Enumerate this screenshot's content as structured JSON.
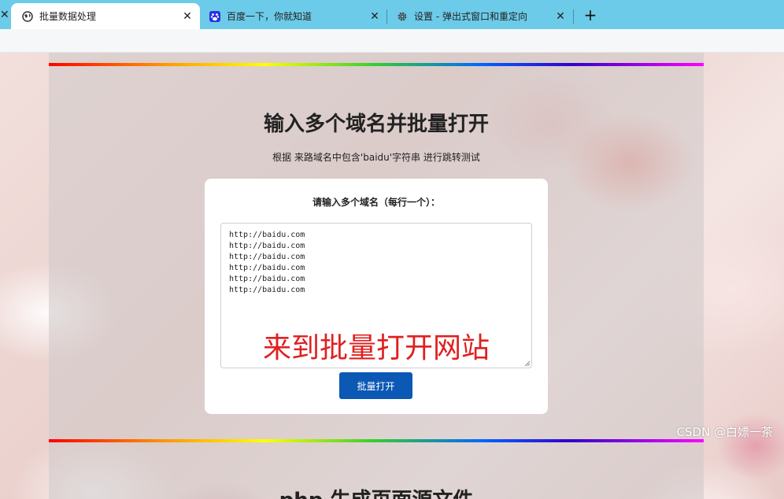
{
  "browser": {
    "tabs": [
      {
        "title": "批量数据处理",
        "favicon": "globe-icon",
        "active": true
      },
      {
        "title": "百度一下，你就知道",
        "favicon": "baidu-paw-icon",
        "active": false
      },
      {
        "title": "设置 - 弹出式窗口和重定向",
        "favicon": "gear-icon",
        "active": false
      }
    ],
    "close_glyph": "✕",
    "new_tab_glyph": "+"
  },
  "page": {
    "heading": "输入多个域名并批量打开",
    "subtitle": "根据 来路域名中包含'baidu'字符串 进行跳转测试",
    "form_label": "请输入多个域名（每行一个）：",
    "domains_value": "http://baidu.com\nhttp://baidu.com\nhttp://baidu.com\nhttp://baidu.com\nhttp://baidu.com\nhttp://baidu.com",
    "overlay_annotation": "来到批量打开网站",
    "submit_label": "批量打开",
    "next_section_heading": "php 生成页面源文件",
    "watermark": "CSDN @白嫖一茶"
  },
  "colors": {
    "tabstrip": "#6ccbe9",
    "button": "#0b58b5",
    "annotation": "#e02020"
  }
}
